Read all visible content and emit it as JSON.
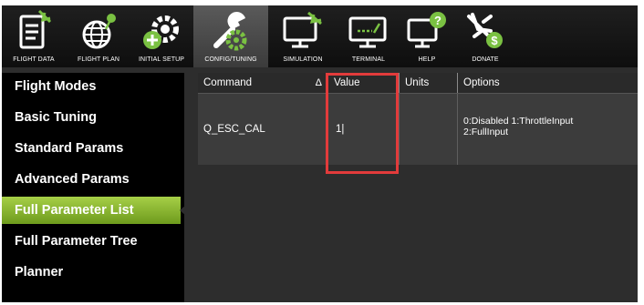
{
  "toolbar": {
    "items": [
      {
        "label": "FLIGHT DATA",
        "icon": "flight-data-icon"
      },
      {
        "label": "FLIGHT PLAN",
        "icon": "flight-plan-icon"
      },
      {
        "label": "INITIAL SETUP",
        "icon": "initial-setup-icon"
      },
      {
        "label": "CONFIG/TUNING",
        "icon": "config-tuning-icon",
        "active": true
      },
      {
        "label": "SIMULATION",
        "icon": "simulation-icon"
      },
      {
        "label": "TERMINAL",
        "icon": "terminal-icon"
      },
      {
        "label": "HELP",
        "icon": "help-icon"
      },
      {
        "label": "DONATE",
        "icon": "donate-icon"
      }
    ],
    "icon_color": "#ffffff",
    "accent_color": "#7ac142"
  },
  "sidebar": {
    "items": [
      {
        "label": "Flight Modes"
      },
      {
        "label": "Basic Tuning"
      },
      {
        "label": "Standard Params"
      },
      {
        "label": "Advanced Params"
      },
      {
        "label": "Full Parameter List",
        "selected": true
      },
      {
        "label": "Full Parameter Tree"
      },
      {
        "label": "Planner"
      }
    ],
    "selected_color": "#8ab733"
  },
  "table": {
    "headers": {
      "command": "Command",
      "value": "Value",
      "units": "Units",
      "options": "Options"
    },
    "sort_indicator": "Δ",
    "rows": [
      {
        "command": "Q_ESC_CAL",
        "value": "1|",
        "units": "",
        "options_line1": "0:Disabled 1:ThrottleInput",
        "options_line2": "2:FullInput"
      }
    ]
  },
  "highlight_color": "#e23b3b"
}
